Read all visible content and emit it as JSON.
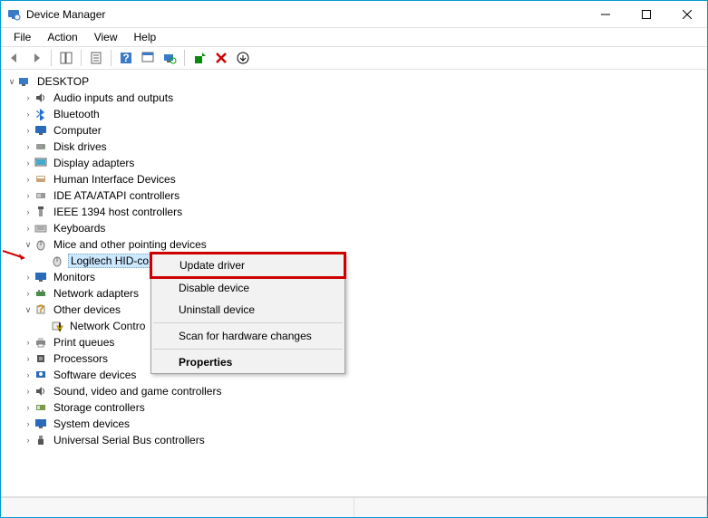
{
  "window": {
    "title": "Device Manager"
  },
  "menu": {
    "file": "File",
    "action": "Action",
    "view": "View",
    "help": "Help"
  },
  "tree": {
    "root": "DESKTOP",
    "audio": "Audio inputs and outputs",
    "bluetooth": "Bluetooth",
    "computer": "Computer",
    "disk": "Disk drives",
    "display": "Display adapters",
    "hid": "Human Interface Devices",
    "ide": "IDE ATA/ATAPI controllers",
    "ieee": "IEEE 1394 host controllers",
    "keyboards": "Keyboards",
    "mice": "Mice and other pointing devices",
    "logitech": "Logitech HID-co",
    "monitors": "Monitors",
    "network": "Network adapters",
    "other": "Other devices",
    "network_contro": "Network Contro",
    "printq": "Print queues",
    "processors": "Processors",
    "software": "Software devices",
    "sound": "Sound, video and game controllers",
    "storage": "Storage controllers",
    "system": "System devices",
    "usb": "Universal Serial Bus controllers"
  },
  "context": {
    "update": "Update driver",
    "disable": "Disable device",
    "uninstall": "Uninstall device",
    "scan": "Scan for hardware changes",
    "properties": "Properties"
  }
}
